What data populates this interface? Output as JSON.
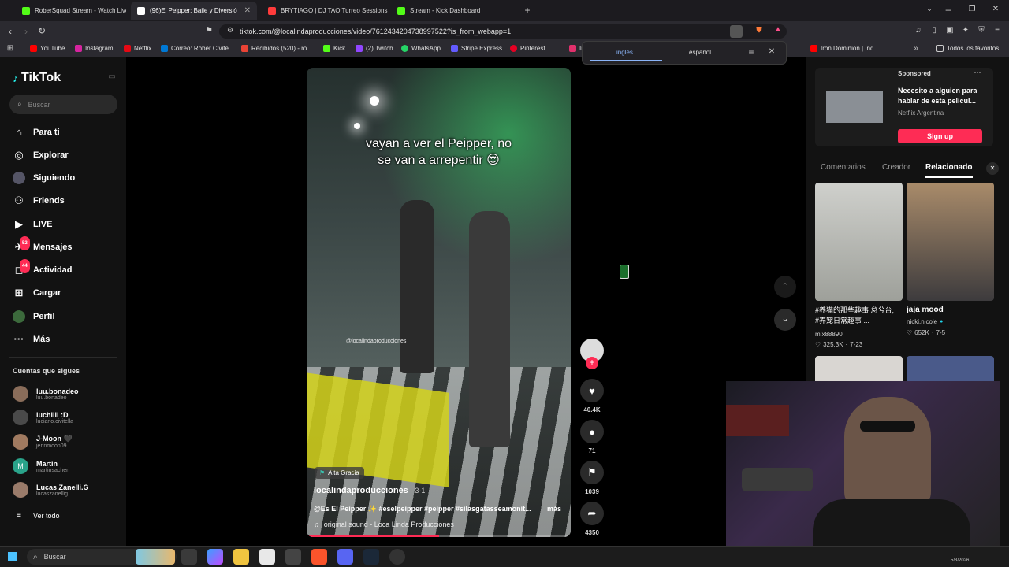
{
  "browser": {
    "tabs": [
      {
        "label": "RoberSquad Stream - Watch Live",
        "color": "#53fc18"
      },
      {
        "label": "(96)El Peipper: Baile y Diversió",
        "color": "#ffffff"
      },
      {
        "label": "BRYTIAGO | DJ TAO Turreo Sessions",
        "color": "#ff3b3b"
      },
      {
        "label": "Stream - Kick Dashboard",
        "color": "#53fc18"
      }
    ],
    "url": "tiktok.com/@localindaproducciones/video/7612434204738997522?is_from_webapp=1",
    "bookmarks": [
      "YouTube",
      "Instagram",
      "Netflix",
      "Correo: Rober Civite...",
      "Recibidos (520) - ro...",
      "Kick",
      "(2) Twitch",
      "WhatsApp",
      "Stripe Express",
      "Pinterest",
      "In"
    ],
    "bookmark_right": "Iron Dominion | Ind...",
    "all_favorites": "Todos los favoritos",
    "translate": {
      "lang1": "inglés",
      "lang2": "español"
    }
  },
  "tiktok": {
    "logo": "TikTok",
    "search_placeholder": "Buscar",
    "nav": [
      {
        "label": "Para ti",
        "icon": "home-icon"
      },
      {
        "label": "Explorar",
        "icon": "compass-icon"
      },
      {
        "label": "Siguiendo",
        "icon": "following-icon"
      },
      {
        "label": "Friends",
        "icon": "friends-icon"
      },
      {
        "label": "LIVE",
        "icon": "live-icon"
      },
      {
        "label": "Mensajes",
        "icon": "messages-icon",
        "badge": "52"
      },
      {
        "label": "Actividad",
        "icon": "activity-icon",
        "badge": "44"
      },
      {
        "label": "Cargar",
        "icon": "upload-icon"
      },
      {
        "label": "Perfil",
        "icon": "profile-icon"
      },
      {
        "label": "Más",
        "icon": "more-icon"
      }
    ],
    "following_title": "Cuentas que sigues",
    "following": [
      {
        "name": "luu.bonadeo",
        "user": "luu.bonadeo"
      },
      {
        "name": "luchiiii :D",
        "user": "luciano.civitella"
      },
      {
        "name": "J-Moon 🖤",
        "user": "jennmoon09"
      },
      {
        "name": "Martin",
        "user": "martinsacheri"
      },
      {
        "name": "Lucas Zanelli.G",
        "user": "lucaszanellig"
      }
    ],
    "see_all": "Ver todo"
  },
  "video": {
    "caption_line1": "vayan a ver el Peipper, no",
    "caption_line2": "se van a arrepentir 😍",
    "watermark": "@localindaproducciones",
    "location": "Alta Gracia",
    "author": "localindaproducciones",
    "date": "3-1",
    "description": "@Es El Peipper ✨ #eselpeipper #peipper #silasgatasseamonit...",
    "more": "más",
    "sound": "original sound - Loca Linda Producciones",
    "progress": 0.5,
    "likes": "40.4K",
    "comments": "71",
    "saves": "1039",
    "shares": "4350"
  },
  "right": {
    "sponsored": "Sponsored",
    "ad_title": "Necesito a alguien para hablar de esta películ...",
    "ad_brand": "Netflix Argentina",
    "ad_button": "Sign up",
    "tabs": [
      "Comentarios",
      "Creador",
      "Relacionado"
    ],
    "related": [
      {
        "title": "#养猫的那些趣事 怠兮台; #养宠日常趣事 ...",
        "user": "mlx88890",
        "likes": "325.3K",
        "date": "7-23"
      },
      {
        "title": "jaja mood",
        "user": "nicki.nicole",
        "likes": "652K",
        "date": "7-5"
      }
    ]
  },
  "taskbar": {
    "search": "Buscar",
    "date": "5/3/2026"
  }
}
